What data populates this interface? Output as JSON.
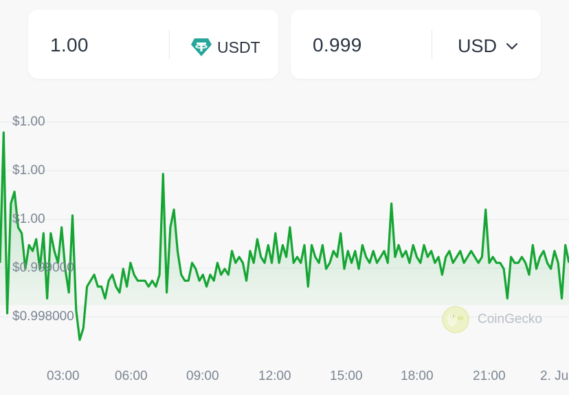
{
  "converter": {
    "from": {
      "amount": "1.00",
      "currency": "USDT",
      "icon": "tether-icon"
    },
    "to": {
      "amount": "0.999",
      "currency": "USD",
      "icon": "chevron-down-icon"
    }
  },
  "watermark": "CoinGecko",
  "colors": {
    "line": "#16a534",
    "fill": "#16a534",
    "grid": "#e9ebee",
    "text": "#7b8593"
  },
  "chart_data": {
    "type": "line",
    "y_tick_labels": [
      "$1.00",
      "$1.00",
      "$1.00",
      "$0.999000",
      "$0.998000"
    ],
    "y_ticks": [
      1.0015,
      1.001,
      1.0005,
      0.999,
      0.998
    ],
    "x_tick_labels": [
      "03:00",
      "06:00",
      "09:00",
      "12:00",
      "15:00",
      "18:00",
      "21:00",
      "2. Ju"
    ],
    "ylim": [
      0.99765,
      1.0017
    ],
    "grid": true,
    "series": [
      {
        "values": [
          0.999,
          1.0012,
          0.99815,
          1.0,
          1.0002,
          0.9996,
          0.9995,
          0.9989,
          0.9993,
          0.9992,
          0.9994,
          0.9989,
          0.9995,
          0.9984,
          0.9995,
          0.9992,
          0.999,
          0.9996,
          0.9989,
          0.9985,
          0.9998,
          0.9982,
          0.9977,
          0.9979,
          0.9986,
          0.9987,
          0.9988,
          0.9986,
          0.9986,
          0.9984,
          0.9987,
          0.9988,
          0.9986,
          0.9985,
          0.9989,
          0.9986,
          0.999,
          0.9988,
          0.9987,
          0.9987,
          0.9987,
          0.9986,
          0.9987,
          0.9986,
          0.9988,
          1.0005,
          0.9985,
          0.9996,
          0.9999,
          0.9992,
          0.9988,
          0.9987,
          0.9987,
          0.999,
          0.9989,
          0.9987,
          0.9988,
          0.9986,
          0.9988,
          0.9987,
          0.999,
          0.9988,
          0.9989,
          0.9988,
          0.9992,
          0.999,
          0.9991,
          0.999,
          0.9987,
          0.9992,
          0.999,
          0.9994,
          0.9991,
          0.999,
          0.9993,
          0.999,
          0.9995,
          0.999,
          0.9993,
          0.9991,
          0.9996,
          0.999,
          0.9991,
          0.999,
          0.9993,
          0.9986,
          0.9993,
          0.9991,
          0.999,
          0.9993,
          0.9989,
          0.999,
          0.9992,
          0.9991,
          0.9995,
          0.9989,
          0.9992,
          0.999,
          0.9992,
          0.9989,
          0.9993,
          0.9991,
          0.999,
          0.9992,
          0.999,
          0.9991,
          0.9992,
          0.999,
          1.0,
          0.9991,
          0.9993,
          0.9991,
          0.9992,
          0.999,
          0.9993,
          0.9991,
          0.999,
          0.9993,
          0.9991,
          0.9992,
          0.999,
          0.9991,
          0.9988,
          0.9991,
          0.9992,
          0.999,
          0.9991,
          0.9992,
          0.999,
          0.9991,
          0.9992,
          0.9991,
          0.999,
          0.9991,
          0.9999,
          0.999,
          0.9991,
          0.999,
          0.999,
          0.9989,
          0.9984,
          0.9991,
          0.999,
          0.999,
          0.9991,
          0.999,
          0.9988,
          0.9993,
          0.9989,
          0.9991,
          0.9992,
          0.999,
          0.9989,
          0.9992,
          0.999,
          0.9984,
          0.9993,
          0.999
        ]
      }
    ]
  }
}
